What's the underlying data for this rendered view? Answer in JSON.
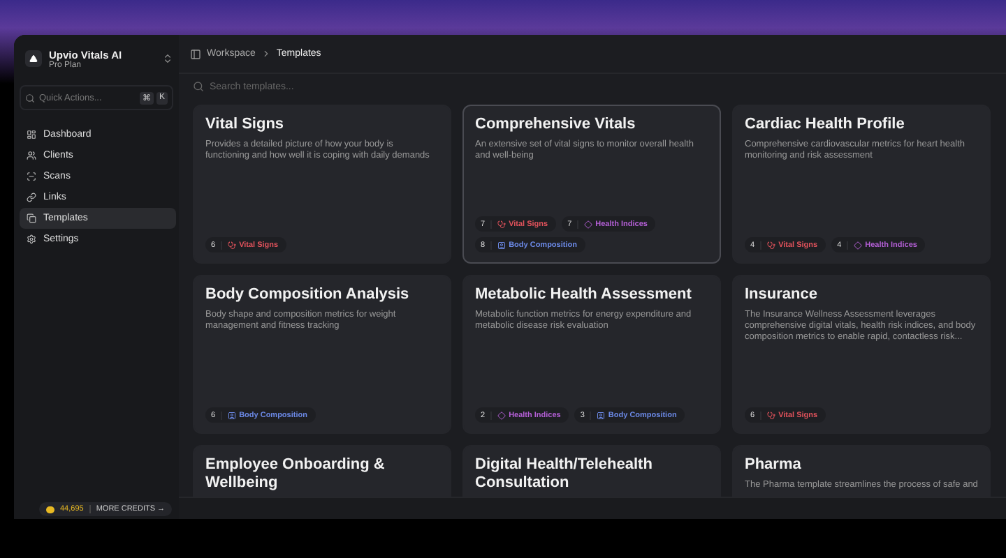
{
  "workspace": {
    "name": "Upvio Vitals AI",
    "plan": "Pro Plan"
  },
  "quick_actions": {
    "placeholder": "Quick Actions...",
    "keys": [
      "⌘",
      "K"
    ]
  },
  "nav": [
    {
      "label": "Dashboard",
      "selected": false
    },
    {
      "label": "Clients",
      "selected": false
    },
    {
      "label": "Scans",
      "selected": false
    },
    {
      "label": "Links",
      "selected": false
    },
    {
      "label": "Templates",
      "selected": true
    },
    {
      "label": "Settings",
      "selected": false
    }
  ],
  "credits": {
    "amount": "44,695",
    "action": "MORE CREDITS →"
  },
  "breadcrumb": [
    "Workspace",
    "Templates"
  ],
  "search": {
    "placeholder": "Search templates..."
  },
  "cards": [
    {
      "title": "Vital Signs",
      "description": "Provides a detailed picture of how your body is functioning and how well it is coping with daily demands",
      "selected": false,
      "tags": [
        {
          "count": "6",
          "label": "Vital Signs",
          "kind": "vital"
        }
      ]
    },
    {
      "title": "Comprehensive Vitals",
      "description": "An extensive set of vital signs to monitor overall health and well-being",
      "selected": true,
      "tags": [
        {
          "count": "7",
          "label": "Vital Signs",
          "kind": "vital"
        },
        {
          "count": "7",
          "label": "Health Indices",
          "kind": "health"
        },
        {
          "count": "8",
          "label": "Body Composition",
          "kind": "body"
        }
      ]
    },
    {
      "title": "Cardiac Health Profile",
      "description": "Comprehensive cardiovascular metrics for heart health monitoring and risk assessment",
      "selected": false,
      "tags": [
        {
          "count": "4",
          "label": "Vital Signs",
          "kind": "vital"
        },
        {
          "count": "4",
          "label": "Health Indices",
          "kind": "health"
        }
      ]
    },
    {
      "title": "Body Composition Analysis",
      "description": "Body shape and composition metrics for weight management and fitness tracking",
      "selected": false,
      "tags": [
        {
          "count": "6",
          "label": "Body Composition",
          "kind": "body"
        }
      ]
    },
    {
      "title": "Metabolic Health Assessment",
      "description": "Metabolic function metrics for energy expenditure and metabolic disease risk evaluation",
      "selected": false,
      "tags": [
        {
          "count": "2",
          "label": "Health Indices",
          "kind": "health"
        },
        {
          "count": "3",
          "label": "Body Composition",
          "kind": "body"
        }
      ]
    },
    {
      "title": "Insurance",
      "description": "The Insurance Wellness Assessment leverages comprehensive digital vitals, health risk indices, and body composition metrics to enable rapid, contactless risk...",
      "selected": false,
      "tags": [
        {
          "count": "6",
          "label": "Vital Signs",
          "kind": "vital"
        }
      ]
    },
    {
      "title": "Employee Onboarding & Wellbeing",
      "selected": false
    },
    {
      "title": "Digital Health/Telehealth Consultation",
      "selected": false
    },
    {
      "title": "Pharma",
      "description": "The Pharma template streamlines the process of safe and",
      "selected": false
    }
  ]
}
